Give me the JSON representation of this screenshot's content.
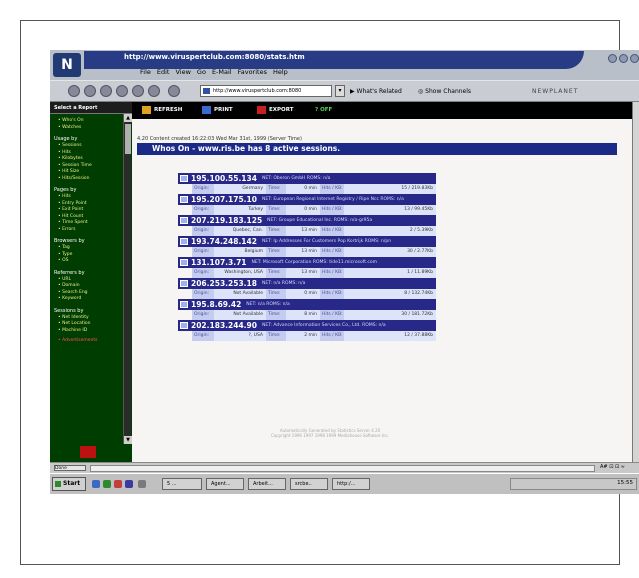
{
  "window": {
    "title": "http://www.viruspertclub.com:8080/stats.htm",
    "menu": [
      "File",
      "Edit",
      "View",
      "Go",
      "E-Mail",
      "Favorites",
      "Help"
    ]
  },
  "toolbar": {
    "address": "http://www.viruspertclub.com:8080",
    "whats_related": "What's Related",
    "show_channels": "Show Channels",
    "brand": "NEWPLANET"
  },
  "sidebar": {
    "header": "Select a Report",
    "sections": [
      {
        "title": "",
        "items": [
          "Who's On",
          "Watches"
        ]
      },
      {
        "title": "Usage by",
        "items": [
          "Sessions",
          "Hits",
          "Kilobytes",
          "Session Time",
          "Hit Size",
          "Hits/Session"
        ]
      },
      {
        "title": "Pages by",
        "items": [
          "Hits",
          "Entry Point",
          "Exit Point",
          "Hit Count",
          "Time Spent",
          "Errors"
        ]
      },
      {
        "title": "Browsers by",
        "items": [
          "Tag",
          "Type",
          "OS"
        ]
      },
      {
        "title": "Referrers by",
        "items": [
          "URL",
          "Domain",
          "Search Eng",
          "Keyword"
        ]
      },
      {
        "title": "Sessions by",
        "items": [
          "Net Identity",
          "Net Location",
          "Machine ID"
        ]
      }
    ],
    "extra": "Advertisements"
  },
  "actions": {
    "refresh": "REFRESH",
    "print": "PRINT",
    "export": "EXPORT",
    "off": "OFF"
  },
  "page": {
    "created": "4.20 Content created 16:22:03 Wed Mar 31st, 1999 (Server Time)",
    "heading": "Whos On - www.ris.be has 8 active sessions."
  },
  "labels": {
    "origin": "Origin:",
    "time": "Time:",
    "hits": "Hits / KB:"
  },
  "sessions": [
    {
      "ip": "195.100.55.134",
      "net": "NET: Oberon GmbH  ROMS: n/a",
      "origin": "Germany",
      "time": "0 min",
      "hits": "15 / 219.83Kb"
    },
    {
      "ip": "195.207.175.10",
      "net": "NET: European Regional Internet Registry / Ripe Ncc  ROMS: n/a",
      "origin": "Turkey",
      "time": "0 min",
      "hits": "13 / 99.45Kb"
    },
    {
      "ip": "207.219.183.125",
      "net": "NET: Groupe Educational Inc.  ROMS: n/a-gr95a",
      "origin": "Quebec, Can.",
      "time": "13 min",
      "hits": "2 / 5.39Kb"
    },
    {
      "ip": "193.74.248.142",
      "net": "NET: Ip Addresses For Customers Pop Kortrijk  ROMS: n/pn",
      "origin": "Belgium",
      "time": "13 min",
      "hits": "30 / 2.77Kb"
    },
    {
      "ip": "131.107.3.71",
      "net": "NET: Microsoft Corporation  ROMS: tide11.microsoft.com",
      "origin": "Washington, USA",
      "time": "13 min",
      "hits": "1 / 11.89Kb"
    },
    {
      "ip": "206.253.253.18",
      "net": "NET: n/a  ROMS: n/a",
      "origin": "Not Available",
      "time": "0 min",
      "hits": "8 / 132.74Kb"
    },
    {
      "ip": "195.8.69.42",
      "net": "NET: n/a  ROMS: n/a",
      "origin": "Not Available",
      "time": "8 min",
      "hits": "30 / 181.72Kb"
    },
    {
      "ip": "202.183.244.90",
      "net": "NET: Advance Information Services Co., Ltd.  ROMS: n/a",
      "origin": "?, USA",
      "time": "2 min",
      "hits": "12 / 37.88Kb"
    }
  ],
  "footer": {
    "line1": "Automatically Generated by Statistics Server 4.20",
    "line2": "Copyright 1996 1997 1998 1999 Mediahouse Software Inc."
  },
  "statusbar": {
    "progress": "Done",
    "zone": "A# ⊡ ⊡ ≈"
  },
  "taskbar": {
    "start": "Start",
    "tasks": [
      "5 ...",
      "Agent...",
      "Arbeit...",
      "srcbe..",
      "http:/..."
    ],
    "clock": "15:55"
  },
  "colors": {
    "sidebar_bg": "#003d00",
    "heading_bg": "#1b2a86",
    "session_head": "#282888"
  }
}
